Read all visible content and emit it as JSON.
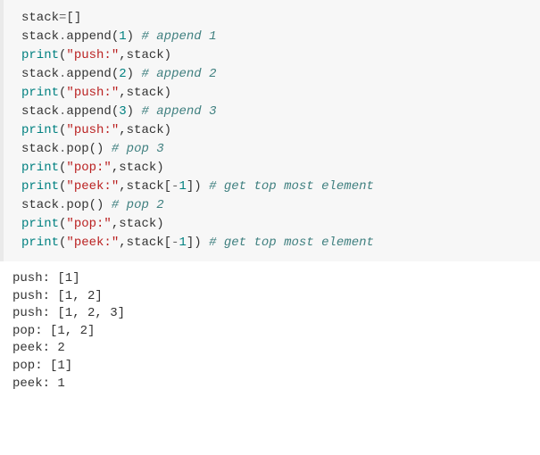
{
  "code": {
    "lines": [
      {
        "id": "l1",
        "tokens": [
          {
            "cls": "tok-id",
            "text": "stack"
          },
          {
            "cls": "tok-op",
            "text": "="
          },
          {
            "cls": "tok-punct",
            "text": "[]"
          }
        ]
      },
      {
        "id": "l2",
        "tokens": [
          {
            "cls": "tok-id",
            "text": "stack"
          },
          {
            "cls": "tok-op",
            "text": "."
          },
          {
            "cls": "tok-id",
            "text": "append"
          },
          {
            "cls": "tok-punct",
            "text": "("
          },
          {
            "cls": "tok-num",
            "text": "1"
          },
          {
            "cls": "tok-punct",
            "text": ") "
          },
          {
            "cls": "tok-comment",
            "text": "# append 1"
          }
        ]
      },
      {
        "id": "l3",
        "tokens": [
          {
            "cls": "tok-func",
            "text": "print"
          },
          {
            "cls": "tok-punct",
            "text": "("
          },
          {
            "cls": "tok-str",
            "text": "\"push:\""
          },
          {
            "cls": "tok-punct",
            "text": ",stack)"
          }
        ]
      },
      {
        "id": "l4",
        "tokens": [
          {
            "cls": "tok-id",
            "text": "stack"
          },
          {
            "cls": "tok-op",
            "text": "."
          },
          {
            "cls": "tok-id",
            "text": "append"
          },
          {
            "cls": "tok-punct",
            "text": "("
          },
          {
            "cls": "tok-num",
            "text": "2"
          },
          {
            "cls": "tok-punct",
            "text": ") "
          },
          {
            "cls": "tok-comment",
            "text": "# append 2"
          }
        ]
      },
      {
        "id": "l5",
        "tokens": [
          {
            "cls": "tok-func",
            "text": "print"
          },
          {
            "cls": "tok-punct",
            "text": "("
          },
          {
            "cls": "tok-str",
            "text": "\"push:\""
          },
          {
            "cls": "tok-punct",
            "text": ",stack)"
          }
        ]
      },
      {
        "id": "l6",
        "tokens": [
          {
            "cls": "tok-id",
            "text": "stack"
          },
          {
            "cls": "tok-op",
            "text": "."
          },
          {
            "cls": "tok-id",
            "text": "append"
          },
          {
            "cls": "tok-punct",
            "text": "("
          },
          {
            "cls": "tok-num",
            "text": "3"
          },
          {
            "cls": "tok-punct",
            "text": ") "
          },
          {
            "cls": "tok-comment",
            "text": "# append 3"
          }
        ]
      },
      {
        "id": "l7",
        "tokens": [
          {
            "cls": "tok-func",
            "text": "print"
          },
          {
            "cls": "tok-punct",
            "text": "("
          },
          {
            "cls": "tok-str",
            "text": "\"push:\""
          },
          {
            "cls": "tok-punct",
            "text": ",stack)"
          }
        ]
      },
      {
        "id": "l8",
        "tokens": [
          {
            "cls": "tok-id",
            "text": "stack"
          },
          {
            "cls": "tok-op",
            "text": "."
          },
          {
            "cls": "tok-id",
            "text": "pop"
          },
          {
            "cls": "tok-punct",
            "text": "() "
          },
          {
            "cls": "tok-comment",
            "text": "# pop 3"
          }
        ]
      },
      {
        "id": "l9",
        "tokens": [
          {
            "cls": "tok-func",
            "text": "print"
          },
          {
            "cls": "tok-punct",
            "text": "("
          },
          {
            "cls": "tok-str",
            "text": "\"pop:\""
          },
          {
            "cls": "tok-punct",
            "text": ",stack)"
          }
        ]
      },
      {
        "id": "l10",
        "tokens": [
          {
            "cls": "tok-func",
            "text": "print"
          },
          {
            "cls": "tok-punct",
            "text": "("
          },
          {
            "cls": "tok-str",
            "text": "\"peek:\""
          },
          {
            "cls": "tok-punct",
            "text": ",stack["
          },
          {
            "cls": "tok-op",
            "text": "-"
          },
          {
            "cls": "tok-num",
            "text": "1"
          },
          {
            "cls": "tok-punct",
            "text": "]) "
          },
          {
            "cls": "tok-comment",
            "text": "# get top most element"
          }
        ]
      },
      {
        "id": "l11",
        "tokens": [
          {
            "cls": "tok-id",
            "text": "stack"
          },
          {
            "cls": "tok-op",
            "text": "."
          },
          {
            "cls": "tok-id",
            "text": "pop"
          },
          {
            "cls": "tok-punct",
            "text": "() "
          },
          {
            "cls": "tok-comment",
            "text": "# pop 2"
          }
        ]
      },
      {
        "id": "l12",
        "tokens": [
          {
            "cls": "tok-func",
            "text": "print"
          },
          {
            "cls": "tok-punct",
            "text": "("
          },
          {
            "cls": "tok-str",
            "text": "\"pop:\""
          },
          {
            "cls": "tok-punct",
            "text": ",stack)"
          }
        ]
      },
      {
        "id": "l13",
        "tokens": [
          {
            "cls": "tok-func",
            "text": "print"
          },
          {
            "cls": "tok-punct",
            "text": "("
          },
          {
            "cls": "tok-str",
            "text": "\"peek:\""
          },
          {
            "cls": "tok-punct",
            "text": ",stack["
          },
          {
            "cls": "tok-op",
            "text": "-"
          },
          {
            "cls": "tok-num",
            "text": "1"
          },
          {
            "cls": "tok-punct",
            "text": "]) "
          },
          {
            "cls": "tok-comment",
            "text": "# get top most element"
          }
        ]
      }
    ]
  },
  "output": {
    "lines": [
      "push: [1]",
      "push: [1, 2]",
      "push: [1, 2, 3]",
      "pop: [1, 2]",
      "peek: 2",
      "pop: [1]",
      "peek: 1"
    ]
  }
}
